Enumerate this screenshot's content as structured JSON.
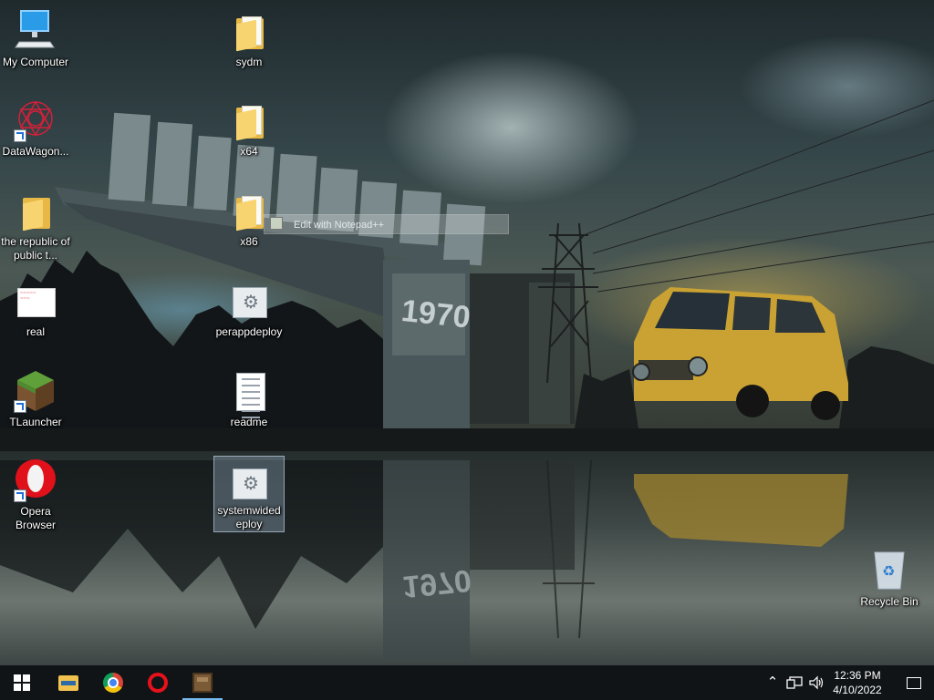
{
  "desktop": {
    "icons": [
      {
        "label": "My Computer",
        "icon": "monitor-icon"
      },
      {
        "label": "DataWagon...",
        "icon": "datawagon-icon"
      },
      {
        "label": "the republic of public t...",
        "icon": "folder-icon"
      },
      {
        "label": "real",
        "icon": "image-icon"
      },
      {
        "label": "TLauncher",
        "icon": "minecraft-block-icon"
      },
      {
        "label": "Opera Browser",
        "icon": "opera-icon"
      },
      {
        "label": "sydm",
        "icon": "folder-icon"
      },
      {
        "label": "x64",
        "icon": "folder-icon"
      },
      {
        "label": "x86",
        "icon": "folder-icon"
      },
      {
        "label": "perappdeploy",
        "icon": "setup-gear-icon"
      },
      {
        "label": "readme",
        "icon": "text-document-icon"
      },
      {
        "label": "systemwidedeploy",
        "icon": "setup-gear-icon"
      },
      {
        "label": "Recycle Bin",
        "icon": "recycle-bin-icon"
      }
    ],
    "context_hint": "Edit with Notepad++",
    "wallpaper_sign_text": "1970"
  },
  "taskbar": {
    "pinned": [
      {
        "name": "File Explorer",
        "icon": "folder-icon"
      },
      {
        "name": "Google Chrome",
        "icon": "chrome-icon"
      },
      {
        "name": "Opera",
        "icon": "opera-icon"
      },
      {
        "name": "TLauncher",
        "icon": "minecraft-block-icon",
        "active": true
      }
    ],
    "tray": {
      "time": "12:36 PM",
      "date": "4/10/2022"
    }
  }
}
